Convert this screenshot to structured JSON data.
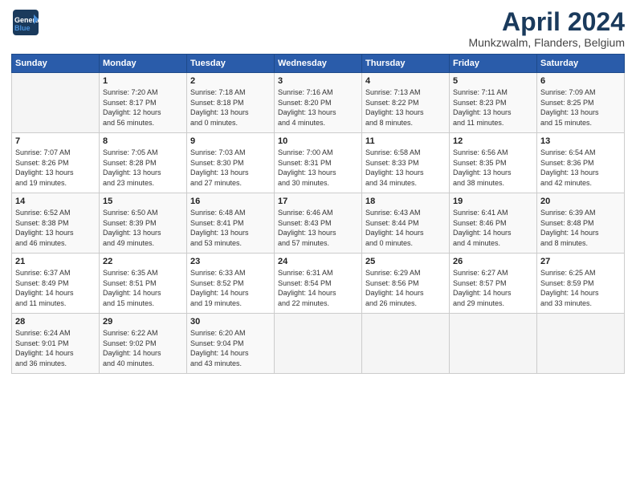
{
  "header": {
    "logo_line1": "General",
    "logo_line2": "Blue",
    "month_title": "April 2024",
    "location": "Munkzwalm, Flanders, Belgium"
  },
  "weekdays": [
    "Sunday",
    "Monday",
    "Tuesday",
    "Wednesday",
    "Thursday",
    "Friday",
    "Saturday"
  ],
  "weeks": [
    [
      {
        "day": "",
        "info": ""
      },
      {
        "day": "1",
        "info": "Sunrise: 7:20 AM\nSunset: 8:17 PM\nDaylight: 12 hours\nand 56 minutes."
      },
      {
        "day": "2",
        "info": "Sunrise: 7:18 AM\nSunset: 8:18 PM\nDaylight: 13 hours\nand 0 minutes."
      },
      {
        "day": "3",
        "info": "Sunrise: 7:16 AM\nSunset: 8:20 PM\nDaylight: 13 hours\nand 4 minutes."
      },
      {
        "day": "4",
        "info": "Sunrise: 7:13 AM\nSunset: 8:22 PM\nDaylight: 13 hours\nand 8 minutes."
      },
      {
        "day": "5",
        "info": "Sunrise: 7:11 AM\nSunset: 8:23 PM\nDaylight: 13 hours\nand 11 minutes."
      },
      {
        "day": "6",
        "info": "Sunrise: 7:09 AM\nSunset: 8:25 PM\nDaylight: 13 hours\nand 15 minutes."
      }
    ],
    [
      {
        "day": "7",
        "info": "Sunrise: 7:07 AM\nSunset: 8:26 PM\nDaylight: 13 hours\nand 19 minutes."
      },
      {
        "day": "8",
        "info": "Sunrise: 7:05 AM\nSunset: 8:28 PM\nDaylight: 13 hours\nand 23 minutes."
      },
      {
        "day": "9",
        "info": "Sunrise: 7:03 AM\nSunset: 8:30 PM\nDaylight: 13 hours\nand 27 minutes."
      },
      {
        "day": "10",
        "info": "Sunrise: 7:00 AM\nSunset: 8:31 PM\nDaylight: 13 hours\nand 30 minutes."
      },
      {
        "day": "11",
        "info": "Sunrise: 6:58 AM\nSunset: 8:33 PM\nDaylight: 13 hours\nand 34 minutes."
      },
      {
        "day": "12",
        "info": "Sunrise: 6:56 AM\nSunset: 8:35 PM\nDaylight: 13 hours\nand 38 minutes."
      },
      {
        "day": "13",
        "info": "Sunrise: 6:54 AM\nSunset: 8:36 PM\nDaylight: 13 hours\nand 42 minutes."
      }
    ],
    [
      {
        "day": "14",
        "info": "Sunrise: 6:52 AM\nSunset: 8:38 PM\nDaylight: 13 hours\nand 46 minutes."
      },
      {
        "day": "15",
        "info": "Sunrise: 6:50 AM\nSunset: 8:39 PM\nDaylight: 13 hours\nand 49 minutes."
      },
      {
        "day": "16",
        "info": "Sunrise: 6:48 AM\nSunset: 8:41 PM\nDaylight: 13 hours\nand 53 minutes."
      },
      {
        "day": "17",
        "info": "Sunrise: 6:46 AM\nSunset: 8:43 PM\nDaylight: 13 hours\nand 57 minutes."
      },
      {
        "day": "18",
        "info": "Sunrise: 6:43 AM\nSunset: 8:44 PM\nDaylight: 14 hours\nand 0 minutes."
      },
      {
        "day": "19",
        "info": "Sunrise: 6:41 AM\nSunset: 8:46 PM\nDaylight: 14 hours\nand 4 minutes."
      },
      {
        "day": "20",
        "info": "Sunrise: 6:39 AM\nSunset: 8:48 PM\nDaylight: 14 hours\nand 8 minutes."
      }
    ],
    [
      {
        "day": "21",
        "info": "Sunrise: 6:37 AM\nSunset: 8:49 PM\nDaylight: 14 hours\nand 11 minutes."
      },
      {
        "day": "22",
        "info": "Sunrise: 6:35 AM\nSunset: 8:51 PM\nDaylight: 14 hours\nand 15 minutes."
      },
      {
        "day": "23",
        "info": "Sunrise: 6:33 AM\nSunset: 8:52 PM\nDaylight: 14 hours\nand 19 minutes."
      },
      {
        "day": "24",
        "info": "Sunrise: 6:31 AM\nSunset: 8:54 PM\nDaylight: 14 hours\nand 22 minutes."
      },
      {
        "day": "25",
        "info": "Sunrise: 6:29 AM\nSunset: 8:56 PM\nDaylight: 14 hours\nand 26 minutes."
      },
      {
        "day": "26",
        "info": "Sunrise: 6:27 AM\nSunset: 8:57 PM\nDaylight: 14 hours\nand 29 minutes."
      },
      {
        "day": "27",
        "info": "Sunrise: 6:25 AM\nSunset: 8:59 PM\nDaylight: 14 hours\nand 33 minutes."
      }
    ],
    [
      {
        "day": "28",
        "info": "Sunrise: 6:24 AM\nSunset: 9:01 PM\nDaylight: 14 hours\nand 36 minutes."
      },
      {
        "day": "29",
        "info": "Sunrise: 6:22 AM\nSunset: 9:02 PM\nDaylight: 14 hours\nand 40 minutes."
      },
      {
        "day": "30",
        "info": "Sunrise: 6:20 AM\nSunset: 9:04 PM\nDaylight: 14 hours\nand 43 minutes."
      },
      {
        "day": "",
        "info": ""
      },
      {
        "day": "",
        "info": ""
      },
      {
        "day": "",
        "info": ""
      },
      {
        "day": "",
        "info": ""
      }
    ]
  ]
}
